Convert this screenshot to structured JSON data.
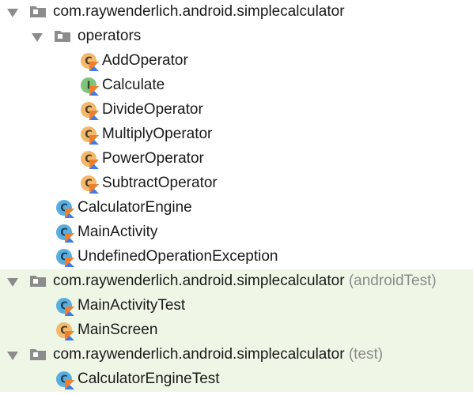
{
  "tree": {
    "main_pkg": {
      "label": "com.raywenderlich.android.simplecalculator"
    },
    "operators": {
      "label": "operators",
      "items": [
        {
          "label": "AddOperator"
        },
        {
          "label": "Calculate"
        },
        {
          "label": "DivideOperator"
        },
        {
          "label": "MultiplyOperator"
        },
        {
          "label": "PowerOperator"
        },
        {
          "label": "SubtractOperator"
        }
      ]
    },
    "main_classes": [
      {
        "label": "CalculatorEngine"
      },
      {
        "label": "MainActivity"
      },
      {
        "label": "UndefinedOperationException"
      }
    ],
    "android_test_pkg": {
      "label": "com.raywenderlich.android.simplecalculator",
      "suffix": "(androidTest)",
      "items": [
        {
          "label": "MainActivityTest"
        },
        {
          "label": "MainScreen"
        }
      ]
    },
    "test_pkg": {
      "label": "com.raywenderlich.android.simplecalculator",
      "suffix": "(test)",
      "items": [
        {
          "label": "CalculatorEngineTest"
        }
      ]
    }
  },
  "colors": {
    "class_blue": "#5aaedf",
    "class_orange": "#f2b86c",
    "interface_green": "#7fc47a",
    "kotlin_orange": "#f07f2a",
    "kotlin_blue": "#3d7be8",
    "folder_gray": "#8c8c8c",
    "test_bg": "#eef7e6"
  }
}
